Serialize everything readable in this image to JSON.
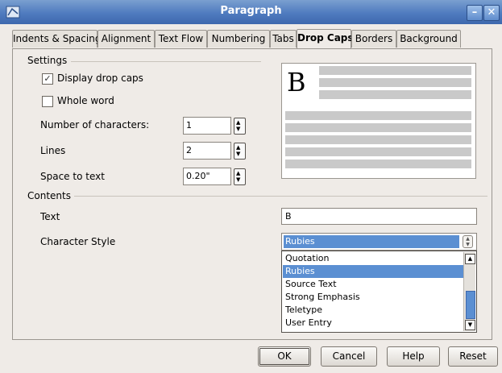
{
  "window": {
    "title": "Paragraph"
  },
  "tabs": [
    {
      "label": "Indents & Spacing"
    },
    {
      "label": "Alignment"
    },
    {
      "label": "Text Flow"
    },
    {
      "label": "Numbering"
    },
    {
      "label": "Tabs"
    },
    {
      "label": "Drop Caps"
    },
    {
      "label": "Borders"
    },
    {
      "label": "Background"
    }
  ],
  "active_tab": "Drop Caps",
  "settings": {
    "heading": "Settings",
    "display_drop_caps": {
      "label": "Display drop caps",
      "checked": true
    },
    "whole_word": {
      "label": "Whole word",
      "checked": false
    },
    "number_of_characters": {
      "label": "Number of characters:",
      "value": "1"
    },
    "lines": {
      "label": "Lines",
      "value": "2"
    },
    "space_to_text": {
      "label": "Space to text",
      "value": "0.20\""
    }
  },
  "preview": {
    "letter": "B"
  },
  "contents": {
    "heading": "Contents",
    "text": {
      "label": "Text",
      "value": "B"
    },
    "character_style": {
      "label": "Character Style",
      "value": "Rubies",
      "options": [
        "Quotation",
        "Rubies",
        "Source Text",
        "Strong Emphasis",
        "Teletype",
        "User Entry"
      ],
      "selected": "Rubies"
    }
  },
  "buttons": {
    "ok": "OK",
    "cancel": "Cancel",
    "help": "Help",
    "reset": "Reset"
  },
  "colors": {
    "titlebar": "#4f7bbf",
    "selection": "#5b8fd2",
    "dialog_bg": "#efebe7"
  }
}
